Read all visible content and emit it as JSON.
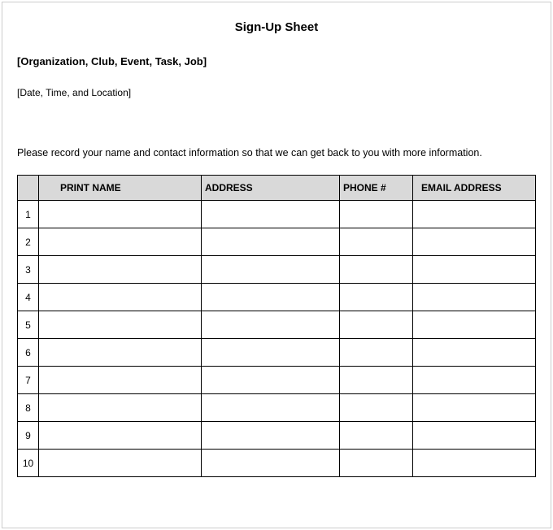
{
  "title": "Sign-Up Sheet",
  "organization_placeholder": "[Organization, Club, Event, Task, Job]",
  "datetime_placeholder": "[Date, Time, and Location]",
  "instruction": "Please record your name and contact information so that we can get back to you with more information.",
  "table": {
    "headers": {
      "num": "",
      "name": "PRINT NAME",
      "address": "ADDRESS",
      "phone": "PHONE #",
      "email": "EMAIL ADDRESS"
    },
    "rows": [
      {
        "num": "1",
        "name": "",
        "address": "",
        "phone": "",
        "email": ""
      },
      {
        "num": "2",
        "name": "",
        "address": "",
        "phone": "",
        "email": ""
      },
      {
        "num": "3",
        "name": "",
        "address": "",
        "phone": "",
        "email": ""
      },
      {
        "num": "4",
        "name": "",
        "address": "",
        "phone": "",
        "email": ""
      },
      {
        "num": "5",
        "name": "",
        "address": "",
        "phone": "",
        "email": ""
      },
      {
        "num": "6",
        "name": "",
        "address": "",
        "phone": "",
        "email": ""
      },
      {
        "num": "7",
        "name": "",
        "address": "",
        "phone": "",
        "email": ""
      },
      {
        "num": "8",
        "name": "",
        "address": "",
        "phone": "",
        "email": ""
      },
      {
        "num": "9",
        "name": "",
        "address": "",
        "phone": "",
        "email": ""
      },
      {
        "num": "10",
        "name": "",
        "address": "",
        "phone": "",
        "email": ""
      }
    ]
  }
}
